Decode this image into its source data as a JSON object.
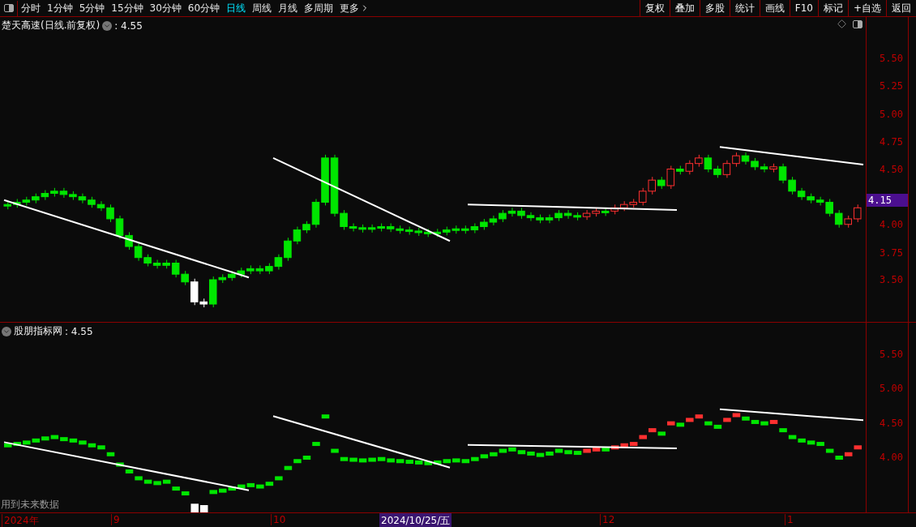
{
  "toolbar": {
    "periods": [
      {
        "label": "分时",
        "selected": false
      },
      {
        "label": "1分钟",
        "selected": false
      },
      {
        "label": "5分钟",
        "selected": false
      },
      {
        "label": "15分钟",
        "selected": false
      },
      {
        "label": "30分钟",
        "selected": false
      },
      {
        "label": "60分钟",
        "selected": false
      },
      {
        "label": "日线",
        "selected": true
      },
      {
        "label": "周线",
        "selected": false
      },
      {
        "label": "月线",
        "selected": false
      },
      {
        "label": "多周期",
        "selected": false
      },
      {
        "label": "更多",
        "selected": false
      }
    ],
    "actions": [
      "复权",
      "叠加",
      "多股",
      "统计",
      "画线",
      "F10",
      "标记",
      "+自选",
      "返回"
    ]
  },
  "main_pane": {
    "title": "楚天高速(日线.前复权)",
    "value": ": 4.55",
    "yticks": [
      "5.50",
      "5.25",
      "5.00",
      "4.75",
      "4.50",
      "4.00",
      "3.75",
      "3.50"
    ],
    "price_tag": "4.15"
  },
  "lower_pane": {
    "title": "股朋指标网",
    "value": ": 4.55",
    "yticks": [
      "5.50",
      "5.00",
      "4.50",
      "4.00"
    ],
    "note": "用到未来数据"
  },
  "date_axis": {
    "labels": [
      "2024年",
      "9",
      "10",
      "12",
      "1"
    ],
    "cursor": "2024/10/25/五"
  }
}
